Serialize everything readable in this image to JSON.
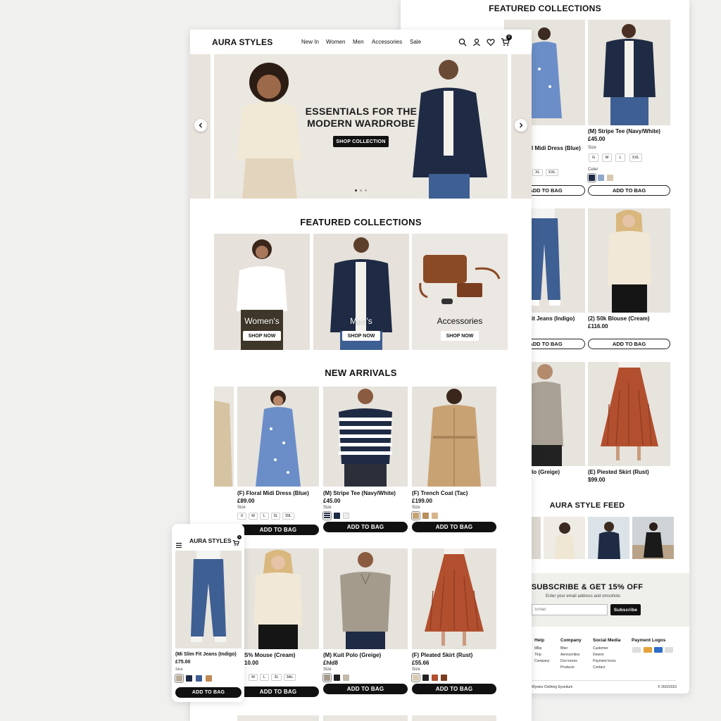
{
  "brand": "AURA STYLES",
  "nav": [
    "New In",
    "Women",
    "Men",
    "Accessories",
    "Sale"
  ],
  "cart_count": "0",
  "hero": {
    "title_line1": "ESSENTIALS FOR THE",
    "title_line2": "MODERN WARDROBE",
    "cta": "SHOP COLLECTION"
  },
  "featured": {
    "title": "FEATURED COLLECTIONS",
    "cards": [
      {
        "label": "Women's",
        "cta": "SHOP NOW"
      },
      {
        "label": "Men's",
        "cta": "SHOP NOW"
      },
      {
        "label": "Accessories",
        "cta": "SHOP NOW"
      }
    ]
  },
  "arrivals": {
    "title": "NEW ARRIVALS",
    "row1": [
      {
        "name": "(F) Floral Midi Dress (Blue)",
        "price": "£89.00",
        "size_label": "Size",
        "sizes": [
          "X",
          "M",
          "L",
          "3L",
          "39L"
        ],
        "cta": "ADD TO BAG"
      },
      {
        "name": "(M) Stripe Tee (Navy/White)",
        "price": "£45.00",
        "size_label": "Size",
        "cta": "ADD TO BAG"
      },
      {
        "name": "(F) Trench Coat (Tac)",
        "price": "£199.00",
        "size_label": "Size",
        "cta": "ADD TO BAG"
      }
    ],
    "row2": [
      {
        "name": "S% Mouse (Cream)",
        "price": "10.00",
        "sizes": [
          "M",
          "L",
          "3L",
          "3AL"
        ],
        "cta": "ADD TO BAG"
      },
      {
        "name": "(M) Kuit Polo (Greige)",
        "price": "£hld8",
        "size_label": "Size",
        "cta": "ADD TO BAG"
      },
      {
        "name": "(F) Pleated Skirt (Rust)",
        "price": "£55.66",
        "size_label": "Size",
        "cta": "ADD TO BAG"
      }
    ]
  },
  "mobile": {
    "brand": "AURA STYLES",
    "product": {
      "name": "(Mi Slim Fit Jeans (Indigo)",
      "price": "£75.00",
      "size_label": "Slce",
      "cta": "ADD TO BAG"
    }
  },
  "right": {
    "featured_title": "FEATURED COLLECTIONS",
    "col1": [
      {
        "name": "l Midi Dress (Blue)",
        "sizes": [
          "XL",
          "XXL"
        ],
        "cta": "ADD TO BAG"
      },
      {
        "name": "it Jeans (Indigo)",
        "cta": "ADD TO BAG"
      },
      {
        "name": "lo (Greige)"
      }
    ],
    "col2": [
      {
        "name": "(M) Stripe Tee (Navy/White)",
        "price": "£45.00",
        "size_label": "Size",
        "sizes": [
          "G",
          "M",
          "L",
          "XXL"
        ],
        "color_label": "Celer",
        "cta": "ADD TO BAG"
      },
      {
        "name": "(2) S0k Blouse (Cream)",
        "price": "£116.00",
        "cta": "ADD TO BAG"
      },
      {
        "name": "(E) Piested Skirt (Rust)",
        "price": "$99.00"
      }
    ],
    "feed_title": "AURA STYLE FEED",
    "subscribe": {
      "title": "SUBSCRIBE & GET 15% OFF",
      "subtitle": "Enter your email address and omsohots",
      "placeholder": "Email",
      "button": "Subscribe"
    },
    "footer": {
      "cols": [
        {
          "title": "Help",
          "items": [
            "Mllip",
            "Tlrip",
            "Company"
          ]
        },
        {
          "title": "Company",
          "items": [
            "Blter",
            "Aenncenties",
            "Dce ineres",
            "Products"
          ]
        },
        {
          "title": "Social Media",
          "items": [
            "Customer",
            "Dewnn",
            "Payment loocs",
            "Contact"
          ]
        },
        {
          "title": "Payment Logos",
          "items": []
        }
      ],
      "bottom_left": "Wystes Clothing Eysedum",
      "bottom_right": "© 26O/2023"
    }
  },
  "colors": {
    "accent": "#111111",
    "page_bg": "#f0f0ef",
    "rust": "#b24f2e",
    "navy": "#1f2b44",
    "denim": "#3e5f93"
  }
}
